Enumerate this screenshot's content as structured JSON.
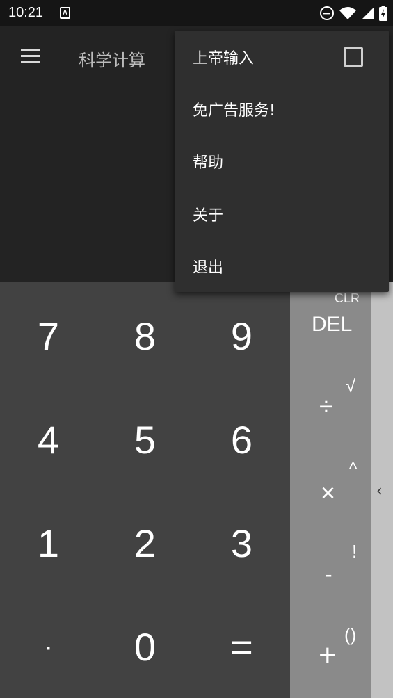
{
  "status_bar": {
    "time": "10:21",
    "notification_icon_letter": "A",
    "icons": [
      "dnd-icon",
      "wifi-icon",
      "signal-icon",
      "battery-charging-icon"
    ]
  },
  "toolbar": {
    "title": "科学计算",
    "menu_icon": "hamburger-menu-icon"
  },
  "overflow_menu": {
    "items": [
      {
        "label": "上帝输入",
        "checkbox": true,
        "checked": false
      },
      {
        "label": "免广告服务!"
      },
      {
        "label": "帮助"
      },
      {
        "label": "关于"
      },
      {
        "label": "退出"
      }
    ]
  },
  "keypad": {
    "rows": [
      [
        "7",
        "8",
        "9"
      ],
      [
        "4",
        "5",
        "6"
      ],
      [
        "1",
        "2",
        "3"
      ],
      [
        "·",
        "0",
        "="
      ]
    ]
  },
  "operators": {
    "clr": "CLR",
    "del": "DEL",
    "divide": "÷",
    "sqrt": "√",
    "multiply": "×",
    "power": "^",
    "minus": "-",
    "factorial": "!",
    "plus": "+",
    "parens": "()"
  },
  "side_panel": {
    "chevron": "‹"
  },
  "colors": {
    "status_bar": "#151515",
    "toolbar": "#232323",
    "numpad": "#424242",
    "operators": "#8a8a8a",
    "side_panel": "#c2c2c2",
    "menu": "#2f2f2f"
  }
}
